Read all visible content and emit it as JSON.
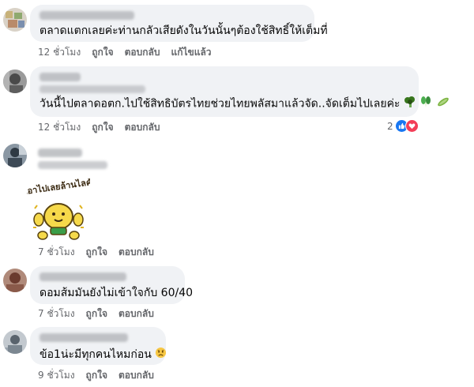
{
  "comments": [
    {
      "text": "ตลาดแตกเลยค่ะท่านกลัวเสียดังในวันนั้นๆต้องใช้สิทธิ์ให้เต็มที่",
      "time": "12 ชั่วโมง",
      "actions": [
        "ถูกใจ",
        "ตอบกลับ",
        "แก้ไขแล้ว"
      ]
    },
    {
      "text": "วันนี้ไปตลาดอตก.ไปใช้สิทธิบัตรไทยช่วยไทยพลัสมาแล้วจัด..จัดเต็มไปเลยค่ะ",
      "time": "12 ชั่วโมง",
      "actions": [
        "ถูกใจ",
        "ตอบกลับ"
      ],
      "reaction_count": "2",
      "trailing_icons": [
        "broccoli-icon",
        "bok-choy-icon",
        "cucumber-icon"
      ]
    },
    {
      "sticker_text": "เอาไปเลยล้านไลค์",
      "time": "7 ชั่วโมง",
      "actions": [
        "ถูกใจ",
        "ตอบกลับ"
      ]
    },
    {
      "text": "ดอมส้มมันยังไม่เข้าใจกับ 60/40",
      "time": "7 ชั่วโมง",
      "actions": [
        "ถูกใจ",
        "ตอบกลับ"
      ]
    },
    {
      "text": "ข้อ1น่ะมีทุกคนไหมก่อน",
      "time": "9 ชั่วโมง",
      "actions": [
        "ถูกใจ",
        "ตอบกลับ"
      ]
    }
  ],
  "colors": {
    "bubble": "#f0f2f5",
    "meta": "#65676b",
    "like": "#1877f2",
    "love": "#f33e58"
  }
}
